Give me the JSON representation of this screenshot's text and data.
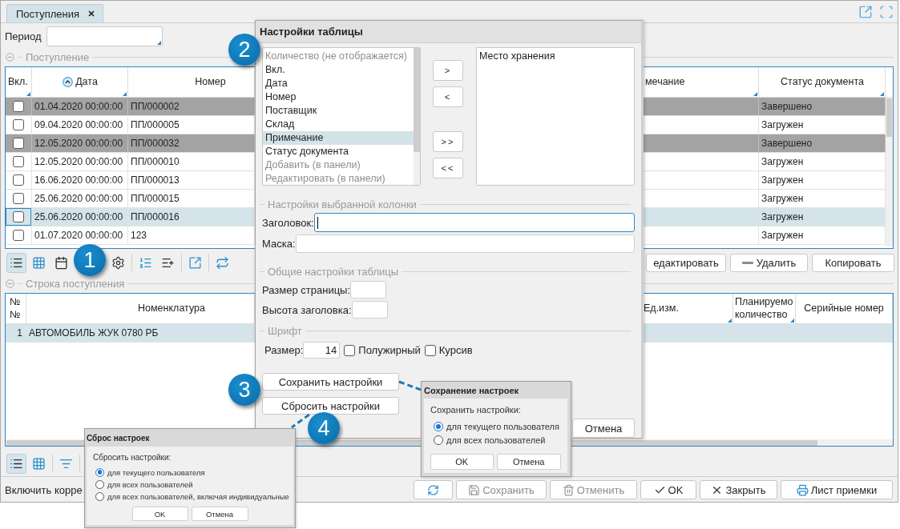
{
  "tab": {
    "label": "Поступления",
    "selected": true
  },
  "period": {
    "label": "Период"
  },
  "receipts": {
    "title": "Поступление",
    "expanded": true,
    "columns": [
      {
        "label": "Вкл.",
        "sorted": false,
        "corner_mark": true
      },
      {
        "label": "Дата",
        "sorted": true,
        "corner_mark": true
      },
      {
        "label": "Номер",
        "sorted": false,
        "corner_mark": false
      },
      {
        "label": "мечание",
        "sorted": false,
        "corner_mark": true
      },
      {
        "label": "Статус документа",
        "sorted": false,
        "corner_mark": true
      }
    ],
    "rows": [
      {
        "checked": false,
        "date": "01.04.2020 00:00:00",
        "number": "ПП/000002",
        "status": "Завершено",
        "shaded": true,
        "selected": false
      },
      {
        "checked": false,
        "date": "09.04.2020 00:00:00",
        "number": "ПП/000005",
        "status": "Загружен",
        "shaded": false,
        "selected": false
      },
      {
        "checked": false,
        "date": "12.05.2020 00:00:00",
        "number": "ПП/000032",
        "status": "Завершено",
        "shaded": true,
        "selected": false
      },
      {
        "checked": false,
        "date": "12.05.2020 00:00:00",
        "number": "ПП/000010",
        "status": "Загружен",
        "shaded": false,
        "selected": false
      },
      {
        "checked": false,
        "date": "16.06.2020 00:00:00",
        "number": "ПП/000013",
        "status": "Загружен",
        "shaded": false,
        "selected": false
      },
      {
        "checked": false,
        "date": "25.06.2020 00:00:00",
        "number": "ПП/000015",
        "status": "Загружен",
        "shaded": false,
        "selected": false
      },
      {
        "checked": false,
        "date": "25.06.2020 00:00:00",
        "number": "ПП/000016",
        "status": "Загружен",
        "shaded": false,
        "selected": true
      },
      {
        "checked": false,
        "date": "01.07.2020 00:00:00",
        "number": "123",
        "status": "Загружен",
        "shaded": false,
        "selected": false
      }
    ],
    "view_modes": [
      {
        "kind": "list",
        "selected": true
      },
      {
        "kind": "grid",
        "selected": false
      },
      {
        "kind": "calendar",
        "selected": false
      }
    ],
    "actions": [
      {
        "label": "едактировать",
        "kind": "text"
      },
      {
        "label": "Удалить",
        "kind": "remove"
      },
      {
        "label": "Копировать",
        "kind": "text"
      }
    ]
  },
  "lines": {
    "title": "Строка поступления",
    "expanded": true,
    "columns": [
      {
        "label": "№№",
        "corner_mark": false
      },
      {
        "label": "Номенклатура",
        "corner_mark": false
      },
      {
        "label": "Ед.изм.",
        "corner_mark": true
      },
      {
        "label": "Планируемо количество",
        "corner_mark": true
      },
      {
        "label": "Серийные номер",
        "corner_mark": false
      }
    ],
    "rows": [
      {
        "number": "1",
        "item": "АВТОМОБИЛЬ ЖУК 0780 РБ",
        "selected": true
      }
    ],
    "view_modes": [
      {
        "kind": "list",
        "selected": true
      },
      {
        "kind": "grid",
        "selected": false
      }
    ]
  },
  "footer": {
    "text": "Включить корре",
    "buttons": [
      {
        "kind": "refresh",
        "disabled": false
      },
      {
        "kind": "save",
        "label": "Сохранить",
        "disabled": true
      },
      {
        "kind": "cancel",
        "label": "Отменить",
        "disabled": true
      },
      {
        "kind": "ok",
        "label": "OK",
        "disabled": false
      },
      {
        "kind": "close",
        "label": "Закрыть",
        "disabled": false
      },
      {
        "kind": "print",
        "label": "Лист приемки",
        "disabled": false
      }
    ]
  },
  "table_settings": {
    "title": "Настройки таблицы",
    "available": [
      {
        "label": "Количество (не отображается)",
        "disabled": true,
        "selected": false
      },
      {
        "label": "Вкл.",
        "disabled": false,
        "selected": false
      },
      {
        "label": "Дата",
        "disabled": false,
        "selected": false
      },
      {
        "label": "Номер",
        "disabled": false,
        "selected": false
      },
      {
        "label": "Поставщик",
        "disabled": false,
        "selected": false
      },
      {
        "label": "Склад",
        "disabled": false,
        "selected": false
      },
      {
        "label": "Примечание",
        "disabled": false,
        "selected": true
      },
      {
        "label": "Статус документа",
        "disabled": false,
        "selected": false
      },
      {
        "label": "Добавить (в панели)",
        "disabled": true,
        "selected": false
      },
      {
        "label": "Редактировать (в панели)",
        "disabled": true,
        "selected": false
      }
    ],
    "move_buttons": [
      ">",
      "<",
      ">>",
      "<<"
    ],
    "hidden": [
      {
        "label": "Место хранения",
        "selected": false
      }
    ],
    "column_section": "Настройки выбранной колонки",
    "column_fields": [
      {
        "label": "Заголовок:",
        "focused": true
      },
      {
        "label": "Маска:",
        "focused": false
      }
    ],
    "general_section": "Общие настройки таблицы",
    "general_fields": [
      {
        "label": "Размер страницы:",
        "focused": false
      },
      {
        "label": "Высота заголовка:",
        "focused": false
      }
    ],
    "font_section": "Шрифт",
    "size_label": "Размер:",
    "size_value": "14",
    "font_options": [
      {
        "label": "Полужирный",
        "checked": false
      },
      {
        "label": "Курсив",
        "checked": false
      }
    ],
    "settings_buttons": [
      "Сохранить настройки",
      "Сбросить настройки"
    ],
    "cancel": "Отмена"
  },
  "save_popup": {
    "title": "Сохранение настроек",
    "prompt": "Сохранить настройки:",
    "options": [
      {
        "label": "для текущего пользователя",
        "selected": true
      },
      {
        "label": "для всех пользователей",
        "selected": false
      }
    ],
    "buttons": [
      "OK",
      "Отмена"
    ]
  },
  "reset_popup": {
    "title": "Сброс настроек",
    "prompt": "Сбросить настройки:",
    "options": [
      {
        "label": "для текущего пользователя",
        "selected": true
      },
      {
        "label": "для всех пользователей",
        "selected": false
      },
      {
        "label": "для всех пользователей, включая индивидуальные",
        "selected": false
      }
    ],
    "buttons": [
      "OK",
      "Отмена"
    ]
  },
  "callouts": [
    "1",
    "2",
    "3",
    "4"
  ]
}
